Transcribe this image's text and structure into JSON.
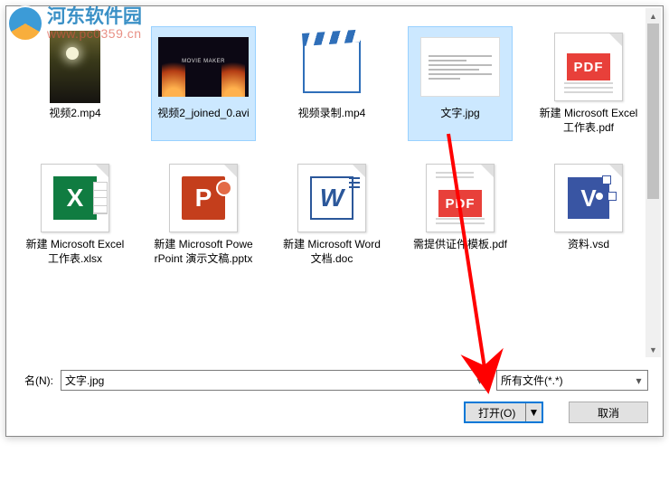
{
  "watermark": {
    "title": "河东软件园",
    "url": "www.pc0359.cn"
  },
  "files": [
    {
      "name": "视频2.mp4",
      "kind": "video-sunset",
      "selected": false
    },
    {
      "name": "视频2_joined_0.avi",
      "kind": "movie-maker",
      "selected": true
    },
    {
      "name": "视频录制.mp4",
      "kind": "clapper",
      "selected": false
    },
    {
      "name": "文字.jpg",
      "kind": "text-image",
      "selected": true
    },
    {
      "name": "新建 Microsoft Excel 工作表.pdf",
      "kind": "pdf",
      "selected": false
    },
    {
      "name": "新建 Microsoft Excel 工作表.xlsx",
      "kind": "excel",
      "selected": false
    },
    {
      "name": "新建 Microsoft PowerPoint 演示文稿.pptx",
      "kind": "ppt",
      "selected": false
    },
    {
      "name": "新建 Microsoft Word 文档.doc",
      "kind": "word",
      "selected": false
    },
    {
      "name": "需提供证件模板.pdf",
      "kind": "pdf-top",
      "selected": false
    },
    {
      "name": "资料.vsd",
      "kind": "visio",
      "selected": false
    }
  ],
  "bottom": {
    "filename_label": "名(N):",
    "filename_value": "文字.jpg",
    "filter_value": "所有文件(*.*)",
    "open_label": "打开(O)",
    "cancel_label": "取消"
  }
}
